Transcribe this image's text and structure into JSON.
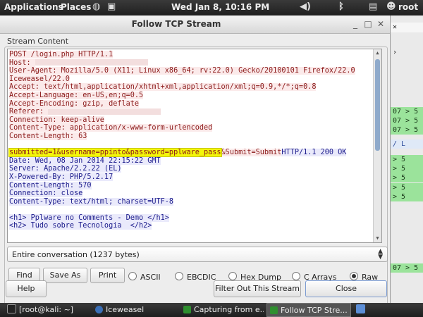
{
  "panel": {
    "applications": "Applications",
    "places": "Places",
    "datetime": "Wed Jan  8, 10:16 PM",
    "user": "root"
  },
  "window": {
    "title": "Follow TCP Stream"
  },
  "stream": {
    "frame_label": "Stream Content",
    "lines": [
      {
        "text": "POST /login.php HTTP/1.1",
        "side": "client"
      },
      {
        "text": "Host: ",
        "side": "client",
        "redacted": true
      },
      {
        "text": "User-Agent: Mozilla/5.0 (X11; Linux x86_64; rv:22.0) Gecko/20100101 Firefox/22.0",
        "side": "client"
      },
      {
        "text": "Iceweasel/22.0",
        "side": "client"
      },
      {
        "text": "Accept: text/html,application/xhtml+xml,application/xml;q=0.9,*/*;q=0.8",
        "side": "client"
      },
      {
        "text": "Accept-Language: en-US,en;q=0.5",
        "side": "client"
      },
      {
        "text": "Accept-Encoding: gzip, deflate",
        "side": "client"
      },
      {
        "text": "Referer: ",
        "side": "client",
        "redacted": true
      },
      {
        "text": "Connection: keep-alive",
        "side": "client"
      },
      {
        "text": "Content-Type: application/x-www-form-urlencoded",
        "side": "client"
      },
      {
        "text": "Content-Length: 63",
        "side": "client"
      },
      {
        "text": "",
        "side": "none"
      },
      {
        "text": "submitted=1&username=ppinto&password=pplware_pass",
        "side": "client",
        "highlight": true,
        "tail_client": "&Submit=Submit",
        "tail_server": "HTTP/1.1 200 OK"
      },
      {
        "text": "Date: Wed, 08 Jan 2014 22:15:22 GMT",
        "side": "server"
      },
      {
        "text": "Server: Apache/2.2.22 (EL)",
        "side": "server"
      },
      {
        "text": "X-Powered-By: PHP/5.2.17",
        "side": "server"
      },
      {
        "text": "Content-Length: 570",
        "side": "server"
      },
      {
        "text": "Connection: close",
        "side": "server"
      },
      {
        "text": "Content-Type: text/html; charset=UTF-8",
        "side": "server"
      },
      {
        "text": "",
        "side": "none"
      },
      {
        "text": "<h1> Pplware no Comments - Demo </h1>",
        "side": "server"
      },
      {
        "text": "<h2> Tudo sobre Tecnologia  </h2>",
        "side": "server"
      }
    ]
  },
  "conversation_select": {
    "value": "Entire conversation (1237 bytes)"
  },
  "actions": {
    "find": "Find",
    "save_as": "Save As",
    "print": "Print"
  },
  "encodings": {
    "options": [
      "ASCII",
      "EBCDIC",
      "Hex Dump",
      "C Arrays",
      "Raw"
    ],
    "selected": "Raw"
  },
  "footer": {
    "help": "Help",
    "filter_out": "Filter Out This Stream",
    "close": "Close"
  },
  "taskbar": {
    "items": [
      "[root@kali: ~]",
      "Iceweasel",
      "Capturing from e...",
      "Follow TCP Stre..."
    ]
  },
  "bg_app": {
    "rows": [
      "07 > 5",
      "07 > 5",
      "07 > 5",
      "/ L",
      "> 5",
      "> 5",
      "> 5",
      "> 5",
      "> 5",
      "07 > 5"
    ]
  },
  "colors": {
    "client_text": "#8b1a1a",
    "client_bg": "#fbeaea",
    "server_text": "#1a1a8b",
    "server_bg": "#eaeafb",
    "highlight": "#f4f70a"
  }
}
